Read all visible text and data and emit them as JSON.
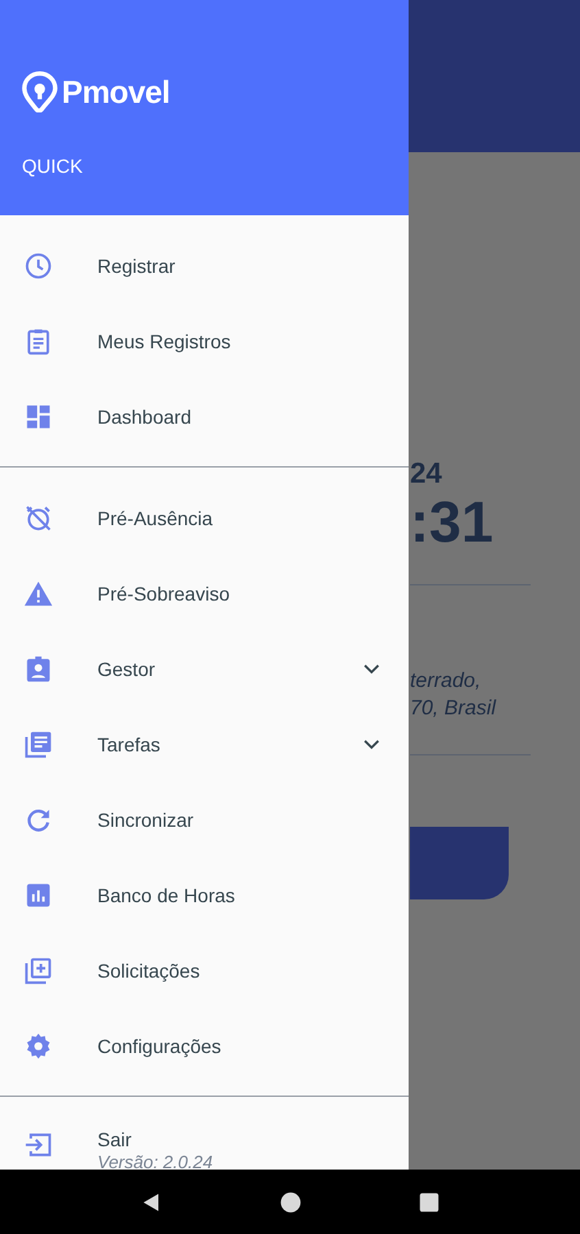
{
  "background": {
    "date_fragment": "24",
    "time_fragment": ":31",
    "address_lines": [
      "terrado,",
      "70, Brasil"
    ]
  },
  "drawer": {
    "brand": "Pmovel",
    "subtitle": "QUICK",
    "sections": [
      {
        "items": [
          {
            "label": "Registrar",
            "kind": "link"
          },
          {
            "label": "Meus Registros",
            "kind": "link"
          },
          {
            "label": "Dashboard",
            "kind": "link"
          }
        ]
      },
      {
        "items": [
          {
            "label": "Pré-Ausência",
            "kind": "link"
          },
          {
            "label": "Pré-Sobreaviso",
            "kind": "link"
          },
          {
            "label": "Gestor",
            "kind": "group"
          },
          {
            "label": "Tarefas",
            "kind": "group"
          },
          {
            "label": "Sincronizar",
            "kind": "link"
          },
          {
            "label": "Banco de Horas",
            "kind": "link"
          },
          {
            "label": "Solicitações",
            "kind": "link"
          },
          {
            "label": "Configurações",
            "kind": "link"
          }
        ]
      }
    ],
    "footer": {
      "label": "Sair",
      "version": "Versão: 2.0.24"
    }
  }
}
